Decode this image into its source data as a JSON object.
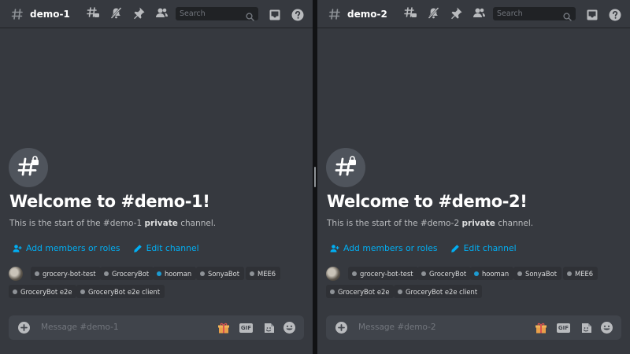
{
  "panes": [
    {
      "channel_name": "demo-1",
      "search_placeholder": "Search",
      "welcome_title": "Welcome to #demo-1!",
      "welcome_sub_prefix": "This is the start of the #demo-1 ",
      "welcome_sub_bold": "private",
      "welcome_sub_suffix": " channel.",
      "add_members_label": "Add members or roles",
      "edit_channel_label": "Edit channel",
      "members": [
        {
          "name": "grocery-bot-test",
          "status": "offline"
        },
        {
          "name": "GroceryBot",
          "status": "offline"
        },
        {
          "name": "hooman",
          "status": "online"
        },
        {
          "name": "SonyaBot",
          "status": "offline"
        },
        {
          "name": "MEE6",
          "status": "offline"
        },
        {
          "name": "GroceryBot e2e",
          "status": "offline"
        },
        {
          "name": "GroceryBot e2e client",
          "status": "offline"
        }
      ],
      "message_placeholder": "Message #demo-1",
      "gif_label": "GIF"
    },
    {
      "channel_name": "demo-2",
      "search_placeholder": "Search",
      "welcome_title": "Welcome to #demo-2!",
      "welcome_sub_prefix": "This is the start of the #demo-2 ",
      "welcome_sub_bold": "private",
      "welcome_sub_suffix": " channel.",
      "add_members_label": "Add members or roles",
      "edit_channel_label": "Edit channel",
      "members": [
        {
          "name": "grocery-bot-test",
          "status": "offline"
        },
        {
          "name": "GroceryBot",
          "status": "offline"
        },
        {
          "name": "hooman",
          "status": "online"
        },
        {
          "name": "SonyaBot",
          "status": "offline"
        },
        {
          "name": "MEE6",
          "status": "offline"
        },
        {
          "name": "GroceryBot e2e",
          "status": "offline"
        },
        {
          "name": "GroceryBot e2e client",
          "status": "offline"
        }
      ],
      "message_placeholder": "Message #demo-2",
      "gif_label": "GIF"
    }
  ],
  "colors": {
    "background": "#36393f",
    "header_text": "#ffffff",
    "link": "#00aff4",
    "online_dot": "#1d9bd1",
    "offline_dot": "#8e9297",
    "composer": "#40444b"
  },
  "icons": [
    "hashtag-lock-icon",
    "threads-icon",
    "mute-icon",
    "pin-icon",
    "members-icon",
    "search-icon",
    "inbox-icon",
    "help-icon",
    "add-member-icon",
    "pencil-icon",
    "plus-icon",
    "gift-icon",
    "gif-icon",
    "sticker-icon",
    "emoji-icon"
  ]
}
